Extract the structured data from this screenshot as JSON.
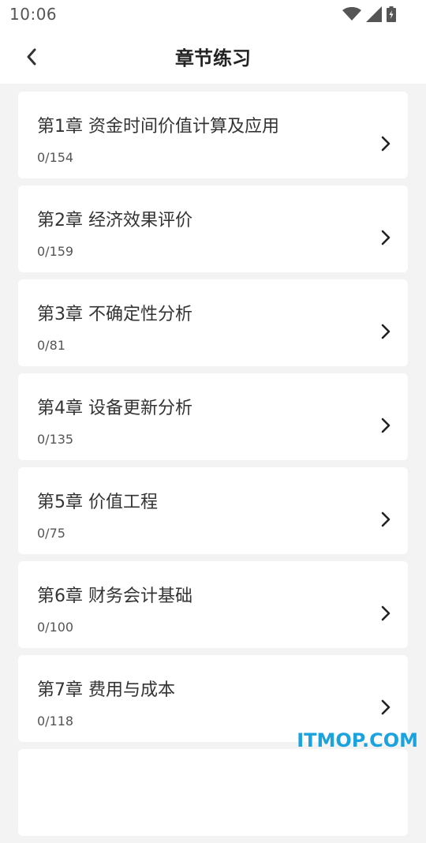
{
  "status_bar": {
    "time": "10:06",
    "icons": [
      "wifi-icon",
      "cell-signal-icon",
      "battery-icon"
    ]
  },
  "header": {
    "title": "章节练习",
    "back_icon": "chevron-left-icon"
  },
  "chapters": [
    {
      "title": "第1章 资金时间价值计算及应用",
      "progress": "0/154"
    },
    {
      "title": "第2章 经济效果评价",
      "progress": "0/159"
    },
    {
      "title": "第3章 不确定性分析",
      "progress": "0/81"
    },
    {
      "title": "第4章 设备更新分析",
      "progress": "0/135"
    },
    {
      "title": "第5章 价值工程",
      "progress": "0/75"
    },
    {
      "title": "第6章 财务会计基础",
      "progress": "0/100"
    },
    {
      "title": "第7章 费用与成本",
      "progress": "0/118"
    }
  ],
  "watermark": "ITMOP.COM",
  "colors": {
    "background": "#f3f3f3",
    "card": "#ffffff",
    "watermark": "#1aa3de"
  }
}
